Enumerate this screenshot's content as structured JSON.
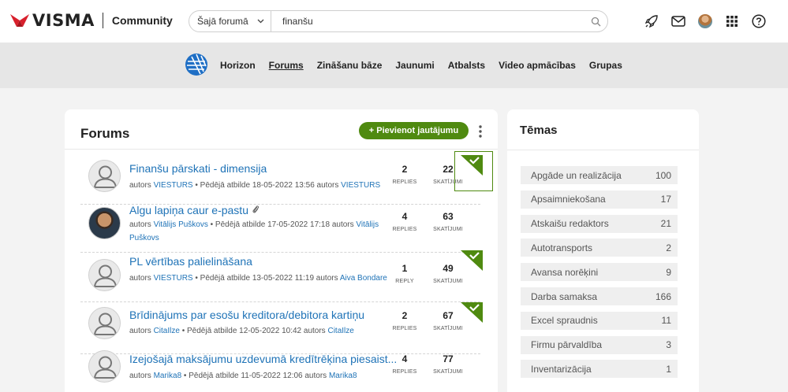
{
  "header": {
    "brand": "VISMA",
    "community": "Community",
    "search_scope": "Šajā forumā",
    "search_value": "finanšu",
    "icons": [
      "rocket-icon",
      "mail-icon",
      "avatar",
      "apps-grid-icon",
      "help-icon"
    ]
  },
  "nav": {
    "items": [
      "Horizon",
      "Forums",
      "Zināšanu bāze",
      "Jaunumi",
      "Atbalsts",
      "Video apmācības",
      "Grupas"
    ],
    "active": "Forums"
  },
  "forums": {
    "title": "Forums",
    "add_button": "+ Pievienot jautājumu",
    "rows": [
      {
        "title": "Finanšu pārskati - dimensija",
        "meta_prefix": "autors",
        "author": "VIESTURS",
        "meta_mid": "• Pēdējā atbilde 18-05-2022 13:56 autors",
        "last_author": "VIESTURS",
        "replies": "2",
        "replies_label": "REPLIES",
        "views": "22",
        "views_label": "SKATĪJUMI",
        "solved": true,
        "attachment": false
      },
      {
        "title": "Algu lapiņa caur e-pastu",
        "meta_prefix": "autors",
        "author": "Vitālijs Puškovs",
        "meta_mid": "• Pēdējā atbilde 17-05-2022 17:18 autors",
        "last_author": "Vitālijs Puškovs",
        "replies": "4",
        "replies_label": "REPLIES",
        "views": "63",
        "views_label": "SKATĪJUMI",
        "solved": false,
        "attachment": true
      },
      {
        "title": "PL vērtības palielināšana",
        "meta_prefix": "autors",
        "author": "VIESTURS",
        "meta_mid": "• Pēdējā atbilde 13-05-2022 11:19 autors",
        "last_author": "Aiva Bondare",
        "replies": "1",
        "replies_label": "REPLY",
        "views": "49",
        "views_label": "SKATĪJUMI",
        "solved": true,
        "attachment": false
      },
      {
        "title": "Brīdinājums par esošu kreditora/debitora kartiņu",
        "meta_prefix": "autors",
        "author": "CitaIlze",
        "meta_mid": "• Pēdējā atbilde 12-05-2022 10:42 autors",
        "last_author": "CitaIlze",
        "replies": "2",
        "replies_label": "REPLIES",
        "views": "67",
        "views_label": "SKATĪJUMI",
        "solved": true,
        "attachment": false
      },
      {
        "title": "Izejošajā maksājumu uzdevumā kredītrēķina piesaist...",
        "meta_prefix": "autors",
        "author": "Marika8",
        "meta_mid": "• Pēdējā atbilde 11-05-2022 12:06 autors",
        "last_author": "Marika8",
        "replies": "4",
        "replies_label": "REPLIES",
        "views": "77",
        "views_label": "SKATĪJUMI",
        "solved": false,
        "attachment": false
      }
    ]
  },
  "topics": {
    "title": "Tēmas",
    "items": [
      {
        "label": "Apgāde un realizācija",
        "count": "100"
      },
      {
        "label": "Apsaimniekošana",
        "count": "17"
      },
      {
        "label": "Atskaišu redaktors",
        "count": "21"
      },
      {
        "label": "Autotransports",
        "count": "2"
      },
      {
        "label": "Avansa norēķini",
        "count": "9"
      },
      {
        "label": "Darba samaksa",
        "count": "166"
      },
      {
        "label": "Excel spraudnis",
        "count": "11"
      },
      {
        "label": "Firmu pārvaldība",
        "count": "3"
      },
      {
        "label": "Inventarizācija",
        "count": "1"
      }
    ]
  },
  "colors": {
    "brand_red": "#d8202c",
    "accent_green": "#4f8a10",
    "link_blue": "#1f73b7"
  }
}
